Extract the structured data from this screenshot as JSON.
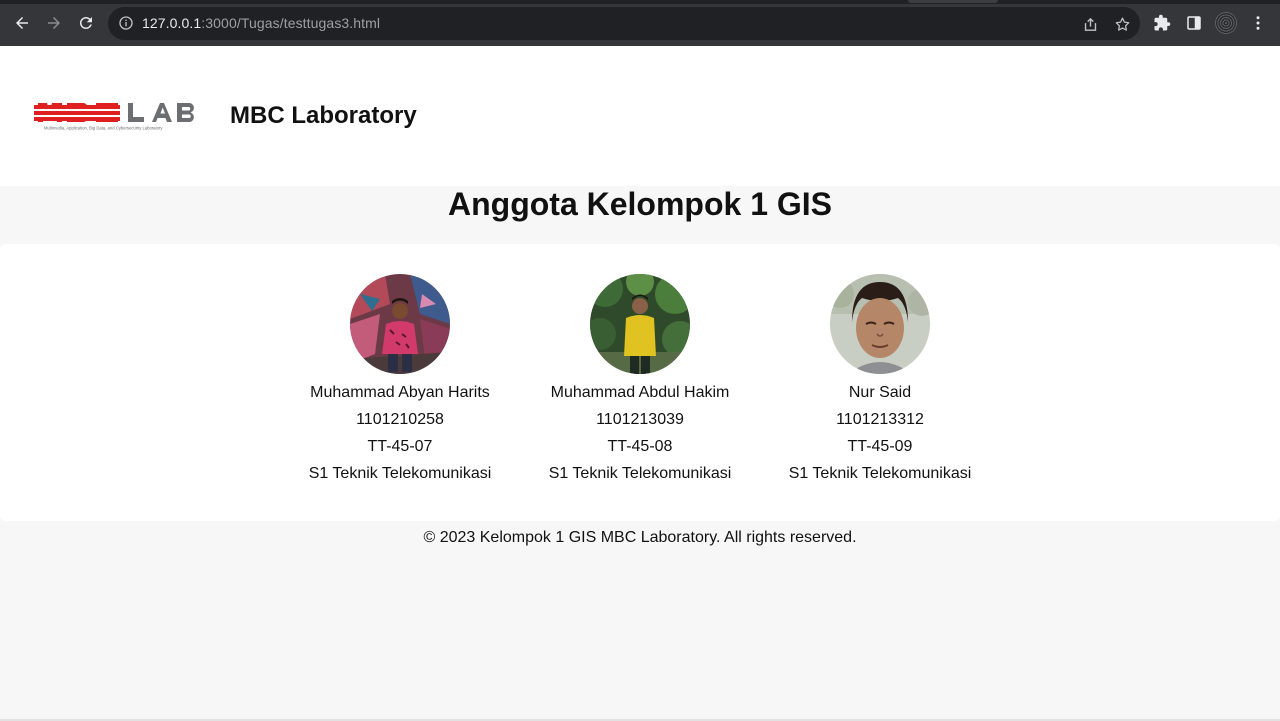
{
  "browser": {
    "url_host": "127.0.0.1",
    "url_path": ":3000/Tugas/testtugas3.html"
  },
  "header": {
    "logo_text": "MBC LAB",
    "logo_tagline": "Multimedia, Application, Big Data, and Cybersecurity Laboratory",
    "title": "MBC Laboratory"
  },
  "page_title": "Anggota Kelompok 1 GIS",
  "members": [
    {
      "name": "Muhammad Abyan Harits",
      "nim": "1101210258",
      "class": "TT-45-07",
      "program": "S1 Teknik Telekomunikasi"
    },
    {
      "name": "Muhammad Abdul Hakim",
      "nim": "1101213039",
      "class": "TT-45-08",
      "program": "S1 Teknik Telekomunikasi"
    },
    {
      "name": "Nur Said",
      "nim": "1101213312",
      "class": "TT-45-09",
      "program": "S1 Teknik Telekomunikasi"
    }
  ],
  "footer": "© 2023 Kelompok 1 GIS MBC Laboratory. All rights reserved.",
  "colors": {
    "chrome_bar": "#35363a",
    "omnibox": "#202124",
    "logo_red": "#e02020",
    "logo_gray": "#6d6e71",
    "page_bg": "#f7f7f7"
  }
}
